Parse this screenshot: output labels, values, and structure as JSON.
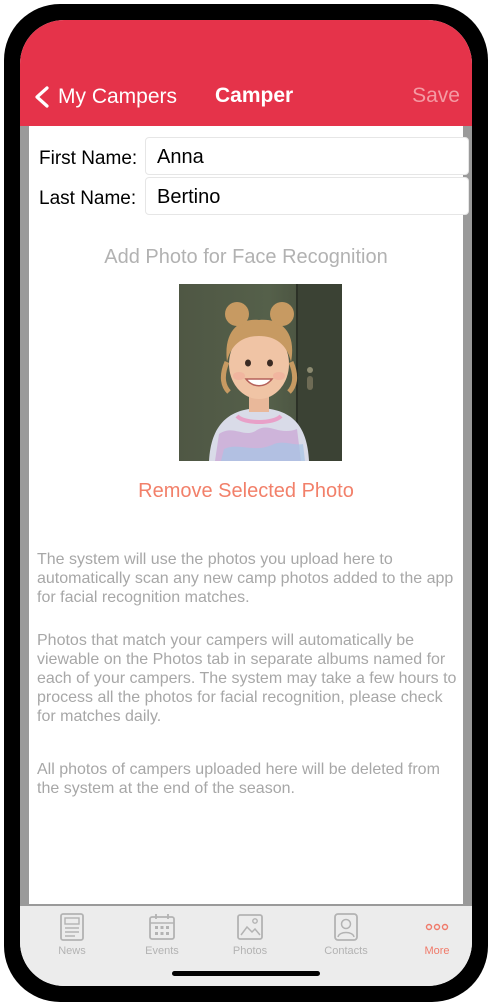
{
  "header": {
    "back_label": "My Campers",
    "title": "Camper",
    "save_label": "Save",
    "accent": "#e5334a"
  },
  "form": {
    "first_name_label": "First Name:",
    "first_name_value": "Anna",
    "last_name_label": "Last Name:",
    "last_name_value": "Bertino"
  },
  "photo": {
    "add_label": "Add Photo for Face Recognition",
    "remove_label": "Remove Selected Photo"
  },
  "info": {
    "p1": "The system will use the photos you upload here to automatically scan any new camp photos added to the app for facial recognition matches.",
    "p2": "Photos that match your campers will automatically be viewable on the Photos tab in separate albums named for each of your campers. The system may take a few hours to process all the photos for facial recognition, please check for matches daily.",
    "p3": "All photos of campers uploaded here will be deleted from the system at the end of the season."
  },
  "tabs": [
    {
      "label": "News",
      "icon": "news-icon"
    },
    {
      "label": "Events",
      "icon": "calendar-icon"
    },
    {
      "label": "Photos",
      "icon": "photo-icon"
    },
    {
      "label": "Contacts",
      "icon": "contact-icon"
    },
    {
      "label": "More",
      "icon": "more-icon",
      "active": true
    }
  ]
}
